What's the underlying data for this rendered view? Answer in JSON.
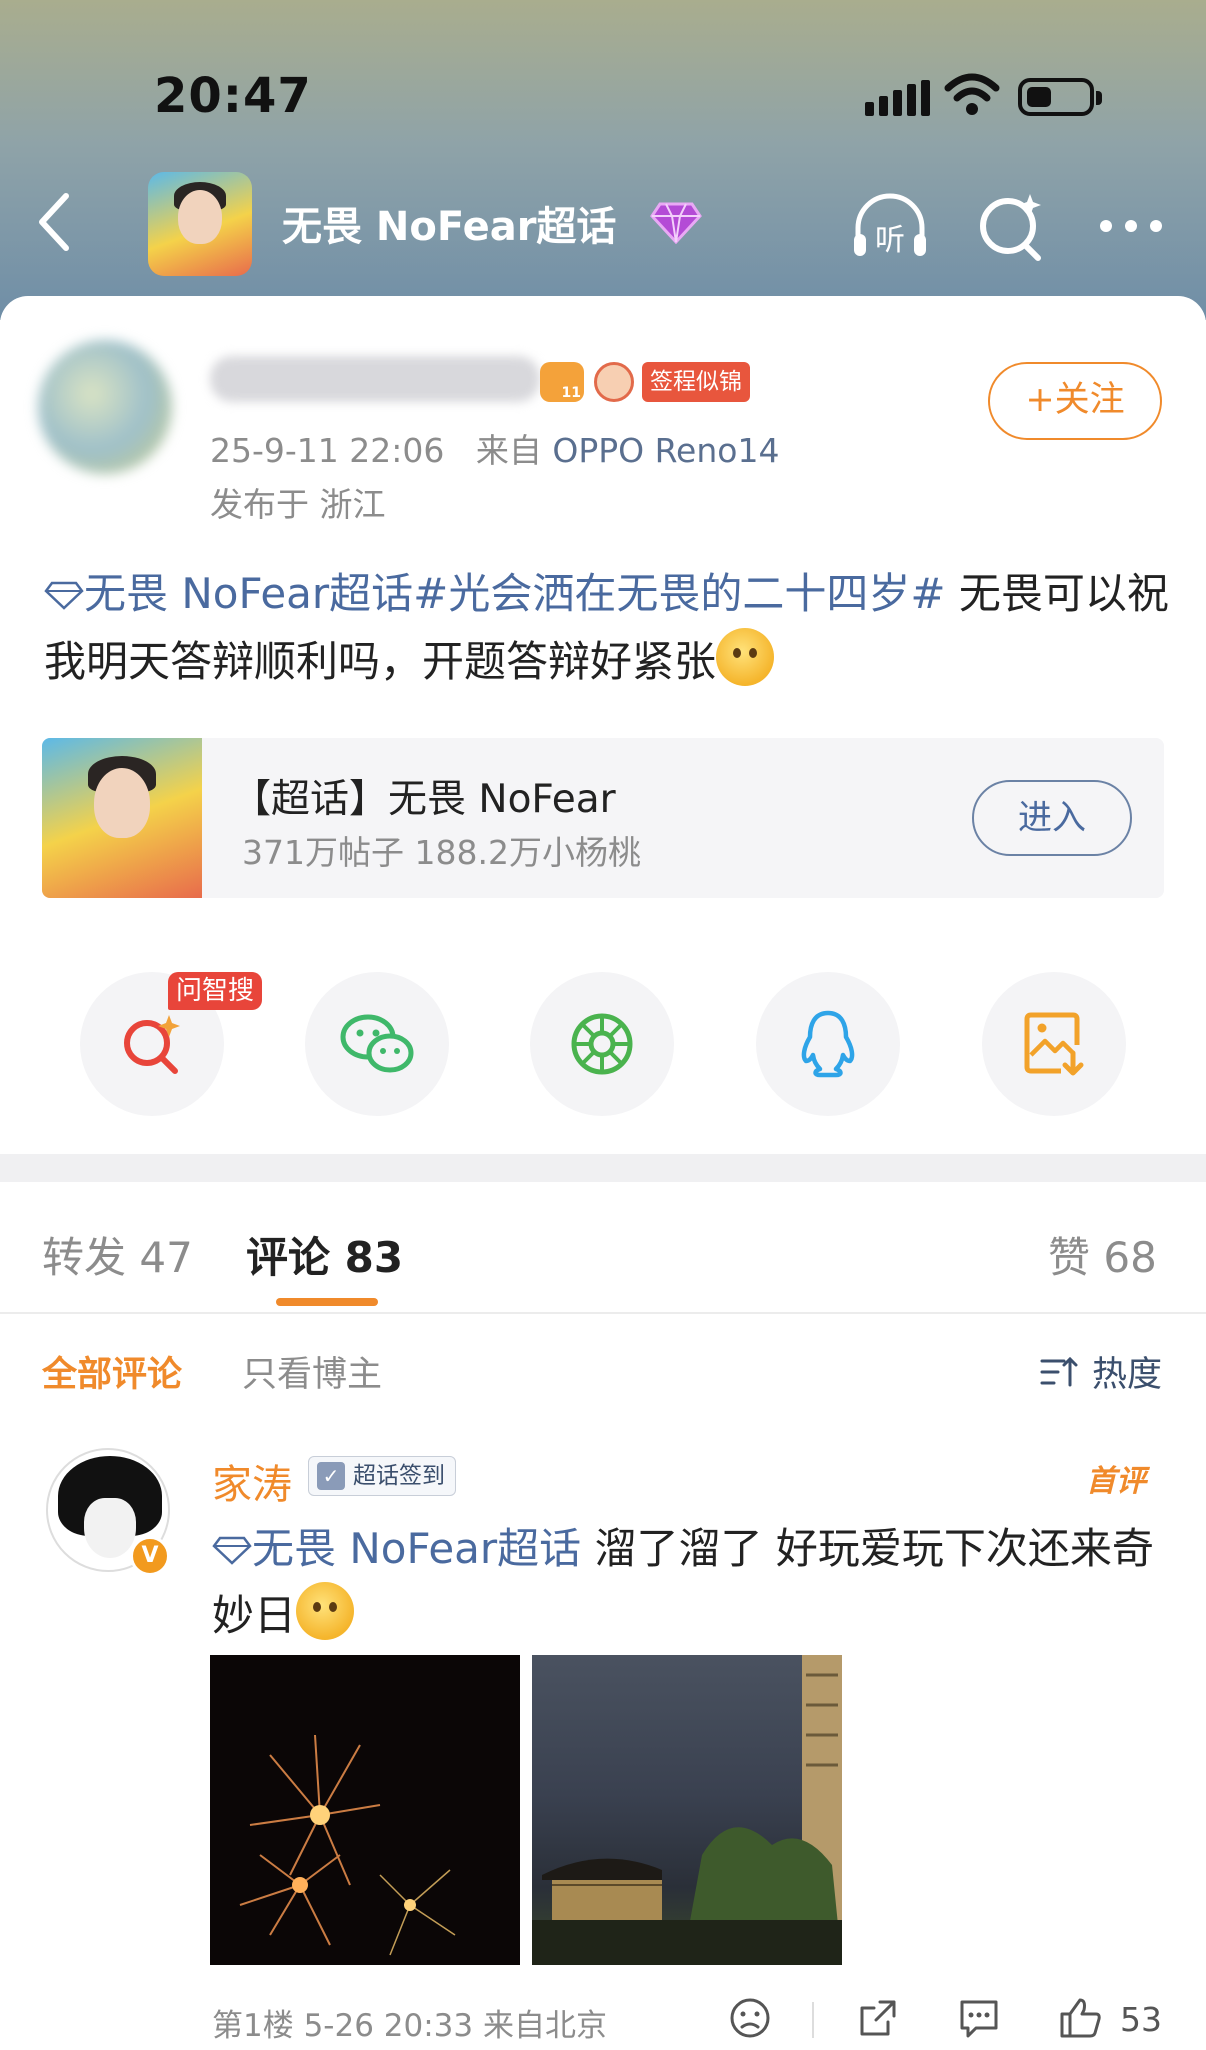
{
  "status_bar": {
    "time": "20:47"
  },
  "nav": {
    "title": "无畏 NoFear超话",
    "icons": [
      "back-icon",
      "listen-icon",
      "ai-search-icon",
      "more-icon"
    ],
    "listen_label": "听"
  },
  "post": {
    "date": "25-9-11 22:06",
    "source_prefix": "来自",
    "device": "OPPO Reno14",
    "location": "发布于 浙江",
    "badge_tag": "签程似锦",
    "follow_label": "+关注",
    "topic_link": "无畏 NoFear超话",
    "hashtag": "#光会洒在无畏的二十四岁#",
    "text": " 无畏可以祝我明天答辩顺利吗，开题答辩好紧张"
  },
  "topic_card": {
    "title": "【超话】无畏 NoFear",
    "subtitle": "371万帖子 188.2万小杨桃",
    "enter_label": "进入"
  },
  "share": {
    "ask_badge": "问智搜",
    "buttons": [
      "ask-search-icon",
      "wechat-icon",
      "moments-icon",
      "qq-icon",
      "save-image-icon"
    ]
  },
  "tabs": {
    "repost": "转发 47",
    "comments": "评论 83",
    "likes": "赞 68"
  },
  "filters": {
    "all": "全部评论",
    "host_only": "只看博主",
    "sort": "热度"
  },
  "comment": {
    "name": "家涛",
    "tag": "超话签到",
    "first_label": "首评",
    "topic_link": "无畏 NoFear超话",
    "text": " 溜了溜了 好玩爱玩下次还来奇妙日",
    "footer": "第1楼 5-26 20:33 来自北京",
    "like_count": "53"
  },
  "colors": {
    "accent": "#f08a2b",
    "link": "#4a6a9f",
    "badge_red": "#e8453a"
  }
}
